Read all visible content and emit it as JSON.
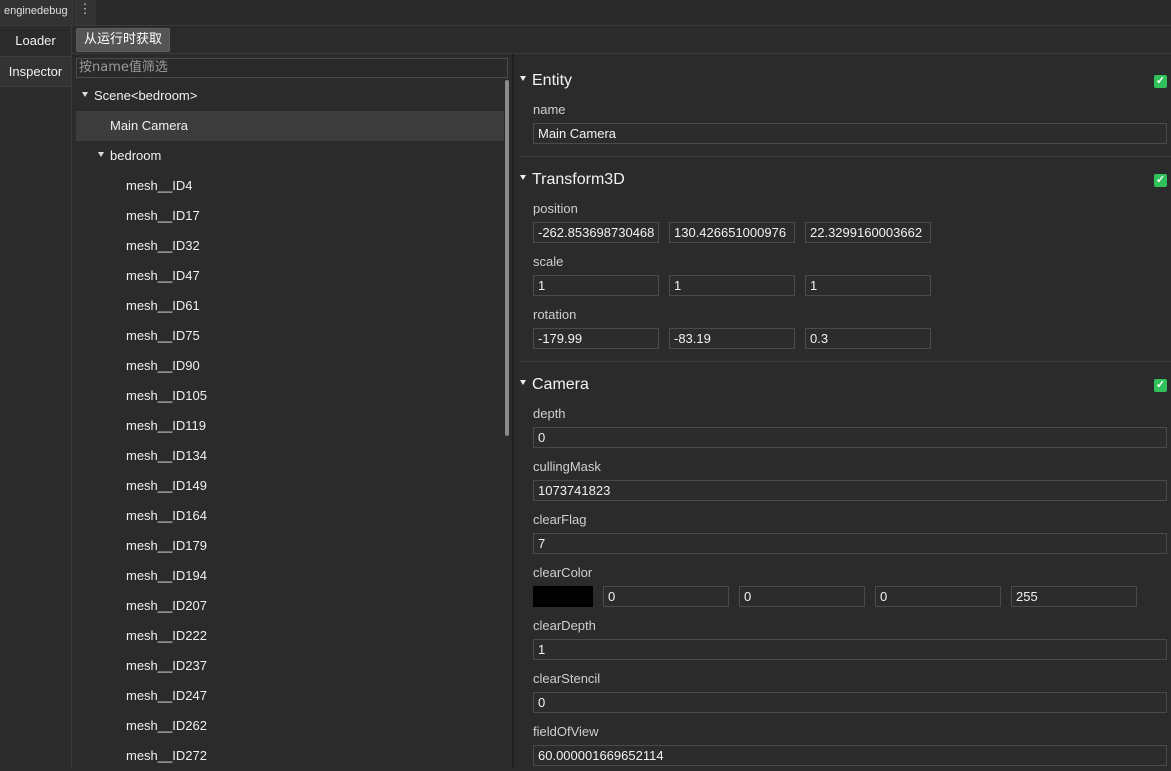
{
  "top_tab": {
    "label": "enginedebug",
    "menu_icon": "kebab-menu-icon"
  },
  "left_nav": [
    {
      "label": "Loader"
    },
    {
      "label": "Inspector"
    }
  ],
  "toolbar": {
    "fetch_label": "从运行时获取"
  },
  "filter": {
    "placeholder": "按name值筛选"
  },
  "tree": {
    "scene_label": "Scene<bedroom>",
    "selected_label": "Main Camera",
    "group_label": "bedroom",
    "items": [
      "mesh__ID4",
      "mesh__ID17",
      "mesh__ID32",
      "mesh__ID47",
      "mesh__ID61",
      "mesh__ID75",
      "mesh__ID90",
      "mesh__ID105",
      "mesh__ID119",
      "mesh__ID134",
      "mesh__ID149",
      "mesh__ID164",
      "mesh__ID179",
      "mesh__ID194",
      "mesh__ID207",
      "mesh__ID222",
      "mesh__ID237",
      "mesh__ID247",
      "mesh__ID262",
      "mesh__ID272"
    ]
  },
  "inspector": {
    "entity": {
      "title": "Entity",
      "enabled": true,
      "name_label": "name",
      "name_value": "Main Camera"
    },
    "transform": {
      "title": "Transform3D",
      "enabled": true,
      "position_label": "position",
      "position": [
        "-262.853698730468",
        "130.426651000976",
        "22.3299160003662"
      ],
      "scale_label": "scale",
      "scale": [
        "1",
        "1",
        "1"
      ],
      "rotation_label": "rotation",
      "rotation": [
        "-179.99",
        "-83.19",
        "0.3"
      ]
    },
    "camera": {
      "title": "Camera",
      "enabled": true,
      "depth_label": "depth",
      "depth": "0",
      "cullingMask_label": "cullingMask",
      "cullingMask": "1073741823",
      "clearFlag_label": "clearFlag",
      "clearFlag": "7",
      "clearColor_label": "clearColor",
      "clearColor_swatch": "#000000",
      "clearColor": [
        "0",
        "0",
        "0",
        "255"
      ],
      "clearDepth_label": "clearDepth",
      "clearDepth": "1",
      "clearStencil_label": "clearStencil",
      "clearStencil": "0",
      "fieldOfView_label": "fieldOfView",
      "fieldOfView": "60.000001669652114"
    }
  }
}
